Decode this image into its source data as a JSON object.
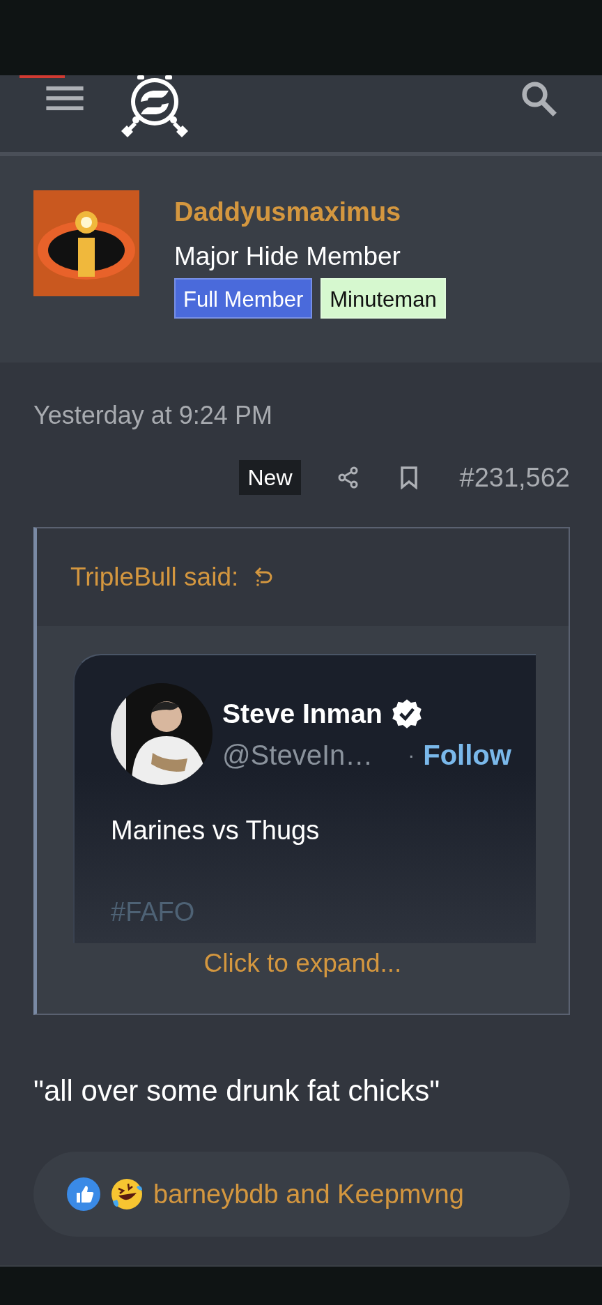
{
  "author": {
    "name": "Daddyusmaximus",
    "title": "Major Hide Member",
    "badges": [
      {
        "label": "Full Member",
        "color": "#4a6adb"
      },
      {
        "label": "Minuteman",
        "color": "#d6f8cf"
      }
    ]
  },
  "post": {
    "time": "Yesterday at 9:24 PM",
    "new_label": "New",
    "number": "#231,562",
    "quote": {
      "author": "TripleBull said:",
      "tweet": {
        "name": "Steve Inman",
        "verified": true,
        "handle": "@SteveIn…",
        "separator": "·",
        "follow": "Follow",
        "text": "Marines vs Thugs",
        "hashtag": "#FAFO"
      },
      "expand": "Click to expand..."
    },
    "text": "\"all over some drunk fat chicks\"",
    "reactions": {
      "users": "barneybdb and Keepmvng"
    }
  }
}
